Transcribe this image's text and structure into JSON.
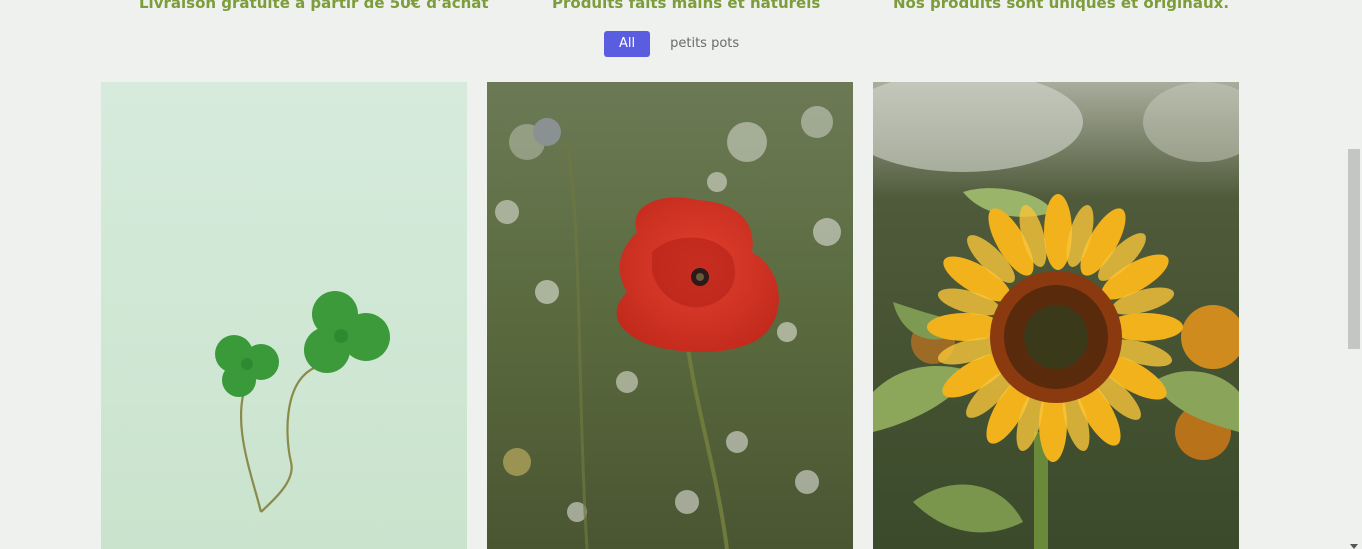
{
  "features": [
    {
      "text": "Livraison gratuite à partir de 50€ d'achat"
    },
    {
      "text": "Produits faits mains et naturels"
    },
    {
      "text": "Nos produits sont uniques et originaux."
    }
  ],
  "filters": {
    "all_label": "All",
    "petits_pots_label": "petits pots"
  },
  "gallery": [
    {
      "subject": "clover"
    },
    {
      "subject": "poppy"
    },
    {
      "subject": "sunflower"
    }
  ],
  "colors": {
    "feature_text": "#7d9c3c",
    "active_filter": "#5a5de0",
    "background": "#eef1ed"
  }
}
